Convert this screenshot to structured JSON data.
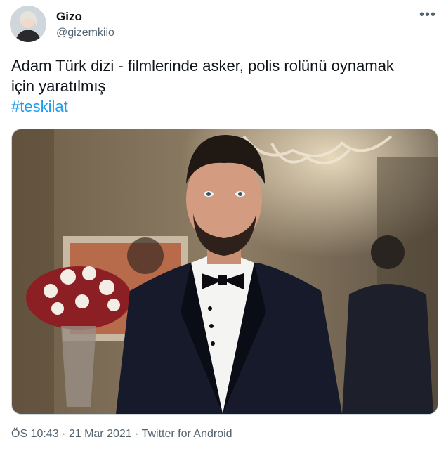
{
  "author": {
    "display_name": "Gizo",
    "handle": "@gizemkiio",
    "avatar_icon": "user-avatar"
  },
  "more_icon": "more-dots-icon",
  "tweet": {
    "text_line1": "Adam Türk dizi - filmlerinde asker, polis rolünü oynamak",
    "text_line2": "için yaratılmış",
    "hashtag": "#teskilat",
    "media_alt": "photo"
  },
  "meta": {
    "time": "ÖS 10:43",
    "separator1": " · ",
    "date": "21 Mar 2021",
    "separator2": " · ",
    "source": "Twitter for Android"
  },
  "colors": {
    "link": "#1d9bf0",
    "secondary_text": "#536471",
    "primary_text": "#0f1419"
  }
}
